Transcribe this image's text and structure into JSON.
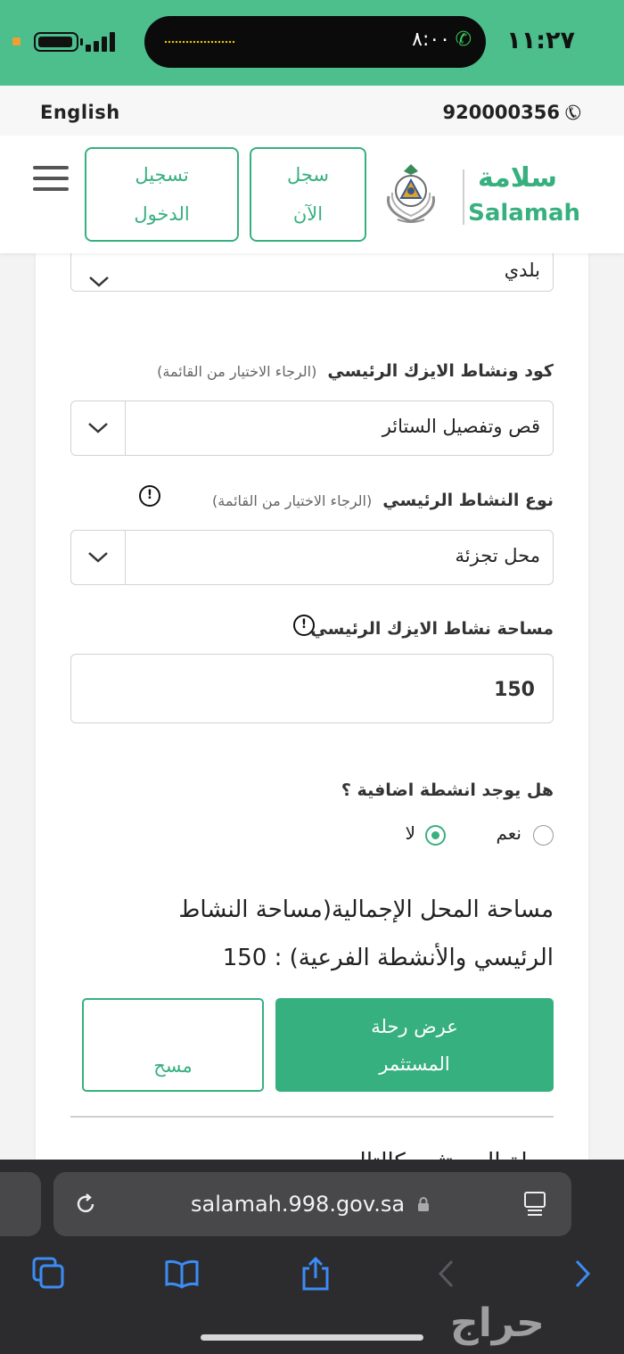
{
  "status_bar": {
    "time": "١١:٢٧",
    "call_duration": "٨:٠٠"
  },
  "top_bar": {
    "language_link": "English",
    "phone_number": "920000356"
  },
  "header": {
    "login_line1": "تسجيل",
    "login_line2": "الدخول",
    "register_line1": "سجل",
    "register_line2": "الآن",
    "brand_ar": "سلامة",
    "brand_en": "Salamah"
  },
  "form": {
    "top_select_value": "بلدي",
    "activity_code": {
      "label": "كود ونشاط الايزك الرئيسي",
      "hint": "(الرجاء الاختيار من القائمة)",
      "value": "قص وتفصيل الستائر"
    },
    "activity_type": {
      "label": "نوع النشاط الرئيسي",
      "hint": "(الرجاء الاختيار من القائمة)",
      "value": "محل تجزئة"
    },
    "activity_area": {
      "label": "مساحة نشاط الايزك الرئيسي",
      "value": "150"
    },
    "additional_activities": {
      "question": "هل يوجد انشطة اضافية ؟",
      "option_yes": "نعم",
      "option_no": "لا",
      "selected": "لا"
    },
    "total_area": {
      "line1": "مساحة المحل الإجمالية(مساحة النشاط",
      "line2": "الرئيسي والأنشطة الفرعية) : 150"
    },
    "show_journey_line1": "عرض رحلة",
    "show_journey_line2": "المستثمر",
    "clear_label": "مسح",
    "next_section_partial": "رحلة المستثمر كالتالي"
  },
  "browser": {
    "url": "salamah.998.gov.sa"
  },
  "watermark": "حراج",
  "colors": {
    "brand_green": "#37b07f",
    "status_bar": "#4cbf8c"
  }
}
